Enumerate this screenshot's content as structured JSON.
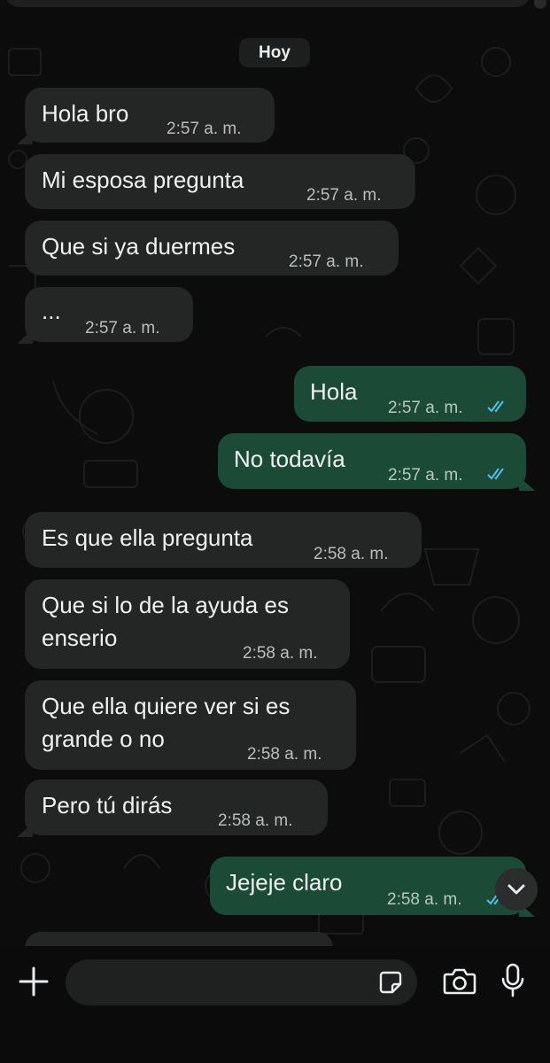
{
  "date_chip": "Hoy",
  "messages": [
    {
      "text": "Hola bro",
      "time": "2:57 a. m."
    },
    {
      "text": "Mi esposa pregunta",
      "time": "2:57 a. m."
    },
    {
      "text": "Que si ya duermes",
      "time": "2:57 a. m."
    },
    {
      "text": "...",
      "time": "2:57 a. m."
    },
    {
      "text": "Hola",
      "time": "2:57 a. m."
    },
    {
      "text": "No todavía",
      "time": "2:57 a. m."
    },
    {
      "text": "Es que ella pregunta",
      "time": "2:58 a. m."
    },
    {
      "line1": "Que si lo de la ayuda es",
      "line2": "enserio",
      "time": "2:58 a. m."
    },
    {
      "line1": "Que ella quiere ver si es",
      "line2": "grande o no",
      "time": "2:58 a. m."
    },
    {
      "text": "Pero tú dirás",
      "time": "2:58 a. m."
    },
    {
      "text": "Jejeje claro",
      "time": "2:58 a. m."
    }
  ],
  "composer": {
    "value": "",
    "placeholder": ""
  },
  "icons": {
    "plus": "plus-icon",
    "sticker": "sticker-icon",
    "camera": "camera-icon",
    "mic": "microphone-icon",
    "scroll": "chevron-down-icon",
    "read_receipt": "double-check-icon"
  },
  "colors": {
    "incoming_bubble": "#242626",
    "outgoing_bubble": "#1b4a36",
    "read_ticks": "#53bdeb",
    "background": "#0c0c0c"
  }
}
